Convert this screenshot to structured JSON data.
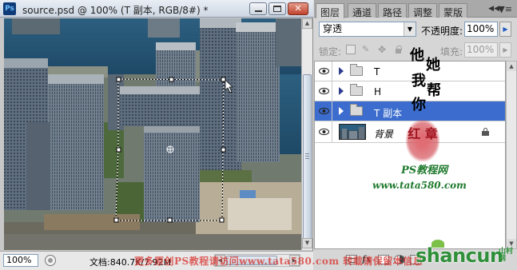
{
  "document": {
    "app_icon": "Ps",
    "title": "source.psd @ 100% (T 副本, RGB/8#) *",
    "zoom": "100%",
    "doc_size": "文档:840.7K/7.92M"
  },
  "panel": {
    "tabs": [
      "图层",
      "通道",
      "路径",
      "调整",
      "蒙版"
    ],
    "active_tab": 0,
    "blend_mode": "穿透",
    "opacity_label": "不透明度:",
    "opacity_value": "100%",
    "lock_label": "锁定:",
    "fill_label": "填充:",
    "fill_value": "100%",
    "layers": [
      {
        "name": "T",
        "type": "group",
        "visible": true,
        "selected": false
      },
      {
        "name": "H",
        "type": "group",
        "visible": true,
        "selected": false
      },
      {
        "name": "T 副本",
        "type": "group",
        "visible": true,
        "selected": true
      },
      {
        "name": "背景",
        "type": "image",
        "visible": true,
        "selected": false,
        "locked": true
      }
    ]
  },
  "watermarks": {
    "vertical_1": [
      "他",
      "她",
      "你"
    ],
    "vertical_2": [
      "我",
      "帮"
    ],
    "seal": "红 章",
    "ps_net": "PS教程网",
    "site": "www.tata580.com",
    "footer": "更多原创PS教程请访问www.tata580.com 转载请保留本信息",
    "brand": "shancun",
    "brand_small": "山村网"
  },
  "colors": {
    "selection": "#3c6dce",
    "watermark_green": "#1f7a2e",
    "brand_green": "#2f8f3a"
  }
}
